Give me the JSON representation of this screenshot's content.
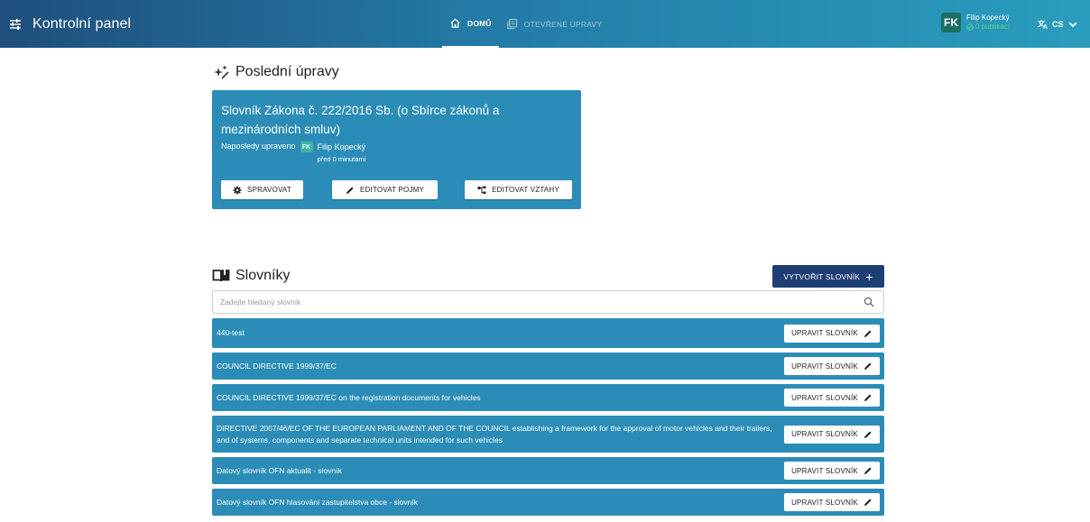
{
  "app": {
    "title": "Kontrolní panel"
  },
  "nav": {
    "tabs": [
      {
        "label": "DOMŮ",
        "icon": "home-icon"
      },
      {
        "label": "OTEVŘENÉ ÚPRAVY",
        "icon": "copy-icon"
      }
    ]
  },
  "user": {
    "initials": "FK",
    "name": "Filip Kopecký",
    "publications": "0 publikací"
  },
  "language": {
    "code": "CS"
  },
  "recent": {
    "heading": "Poslední úpravy",
    "card": {
      "title": "Slovník Zákona č. 222/2016 Sb. (o Sbírce zákonů a mezinárodních smluv)",
      "edited_label": "Naposledy upraveno",
      "user_initials": "FK",
      "user_name": "Filip Kopecký",
      "ago": "před 0 minutami",
      "actions": [
        "SPRAVOVAT",
        "EDITOVAT POJMY",
        "EDITOVAT VZTAHY"
      ]
    }
  },
  "vocabularies": {
    "heading": "Slovníky",
    "create_label": "VYTVOŘIT SLOVNÍK",
    "create_plus": "+",
    "search_placeholder": "Zadejte hledaný slovník",
    "edit_label": "UPRAVIT SLOVNÍK",
    "items": [
      "440-test",
      "COUNCIL DIRECTIVE 1999/37/EC",
      "COUNCIL DIRECTIVE 1999/37/EC on the registration documents for vehicles",
      "DIRECTIVE 2007/46/EC OF THE EUROPEAN PARLIAMENT AND OF THE COUNCIL establishing a framework for the approval of motor vehicles and their trailers, and of systems, components and separate technical units intended for such vehicles",
      "Datový slovník OFN aktualit - slovník",
      "Datový slovník OFN hlasování zastupitelstva obce - slovník"
    ]
  },
  "colors": {
    "primary": "#2b8db7",
    "dark_button": "#1f3f74",
    "status_green": "#53d18c"
  }
}
